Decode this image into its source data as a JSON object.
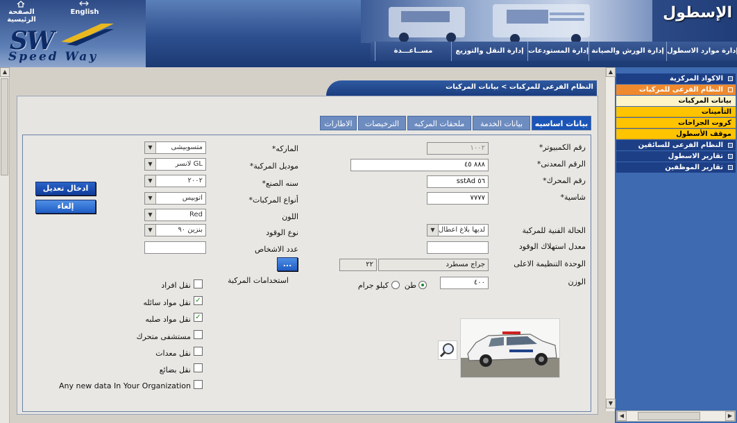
{
  "header": {
    "app_title": "الإسطول",
    "home_label": "الصفحة الرئيسية",
    "english_label": "English",
    "logo_text": "SW",
    "logo_sub": "Speed  Way",
    "nav": [
      "إدارة موارد الاسطول",
      "إدارة الورش والصيانة",
      "إدارة المستودعات",
      "إدارة النقل والتوزيع",
      "مســاعـــدة"
    ]
  },
  "sidebar": {
    "items": [
      {
        "label": "الاكواد المركزية",
        "style": "dark"
      },
      {
        "label": "النظام الفرعى للمركبات",
        "style": "orange"
      },
      {
        "label": "بيانات المركبات",
        "style": "light"
      },
      {
        "label": "التأمينات",
        "style": "yellow"
      },
      {
        "label": "كروت الجراحات",
        "style": "yellow"
      },
      {
        "label": "موقف الأسطول",
        "style": "yellow"
      },
      {
        "label": "النظام الفرعى للسائقين",
        "style": "dark"
      },
      {
        "label": "تقارير الاسطول",
        "style": "dark"
      },
      {
        "label": "تقارير الموظفين",
        "style": "dark"
      }
    ]
  },
  "breadcrumb": "النظام الفرعى للمركبات > بيانات المركبات",
  "tabs": [
    "بيانات اساسيه",
    "بيانات الخدمة",
    "ملحقات المركبه",
    "الترخيصات",
    "الاطارات"
  ],
  "form": {
    "computer_no": {
      "label": "*رقم الكمبيوتر",
      "value": "١٠٠٢"
    },
    "metal_no": {
      "label": "*الرقم المعدنى",
      "value": "٨٨٨ ٤٥"
    },
    "engine_no": {
      "label": "*رقم المحرك",
      "value": "sstAd ٥٦"
    },
    "chassis": {
      "label": "*شاسية",
      "value": "٧٧٧٧"
    },
    "tech_status": {
      "label": "الحالة الفنية للمركبة",
      "value": "لديها بلاغ اعطال"
    },
    "fuel_rate": {
      "label": "معدل استهلاك الوقود",
      "value": ""
    },
    "parent_unit": {
      "label": "الوحدة التنظيمة الاعلى",
      "name": "جراج مسطرد",
      "code": "٢٢"
    },
    "weight": {
      "label": "الوزن",
      "value": "٤٠٠",
      "unit_ton": "طن",
      "unit_kg": "كيلو جرام"
    },
    "brand": {
      "label": "*الماركه",
      "value": "متسوبيشى"
    },
    "model": {
      "label": "*موديل المركبة",
      "value": "لانسر GL"
    },
    "year": {
      "label": "*سنه الصنع",
      "value": "٢٠٠٢"
    },
    "types": {
      "label": "*أنواع المركبات",
      "value": "اتوبيس"
    },
    "color": {
      "label": "اللون",
      "value": "Red"
    },
    "fuel_type": {
      "label": "نوع الوقود",
      "value": "بنزين ٩٠"
    },
    "persons": {
      "label": "عدد الاشخاص",
      "value": ""
    },
    "usages": {
      "label": "استخدامات المركبة",
      "button": "..."
    },
    "checks": [
      {
        "label": "نقل افراد",
        "checked": false
      },
      {
        "label": "نقل مواد سائله",
        "checked": true
      },
      {
        "label": "نقل مواد صلبه",
        "checked": true
      },
      {
        "label": "مستشفى متحرك",
        "checked": false
      },
      {
        "label": "نقل معدات",
        "checked": false
      },
      {
        "label": "نقل بضائع",
        "checked": false
      },
      {
        "label": "Any new data In Your Organization",
        "checked": false
      }
    ],
    "submit_label": "ادخال تعديل",
    "cancel_label": "إلغاء",
    "check_mark": "✓",
    "dropdown_arrow": "▼"
  },
  "colors": {
    "accent": "#1b55b8",
    "header": "#2d4f8e",
    "menu_dark": "#1d3f86",
    "menu_orange": "#f08a2e",
    "menu_yellow": "#ffc400"
  },
  "icons": {
    "home": "home-icon",
    "zoom": "magnifier-icon",
    "photo": "vehicle-photo"
  }
}
